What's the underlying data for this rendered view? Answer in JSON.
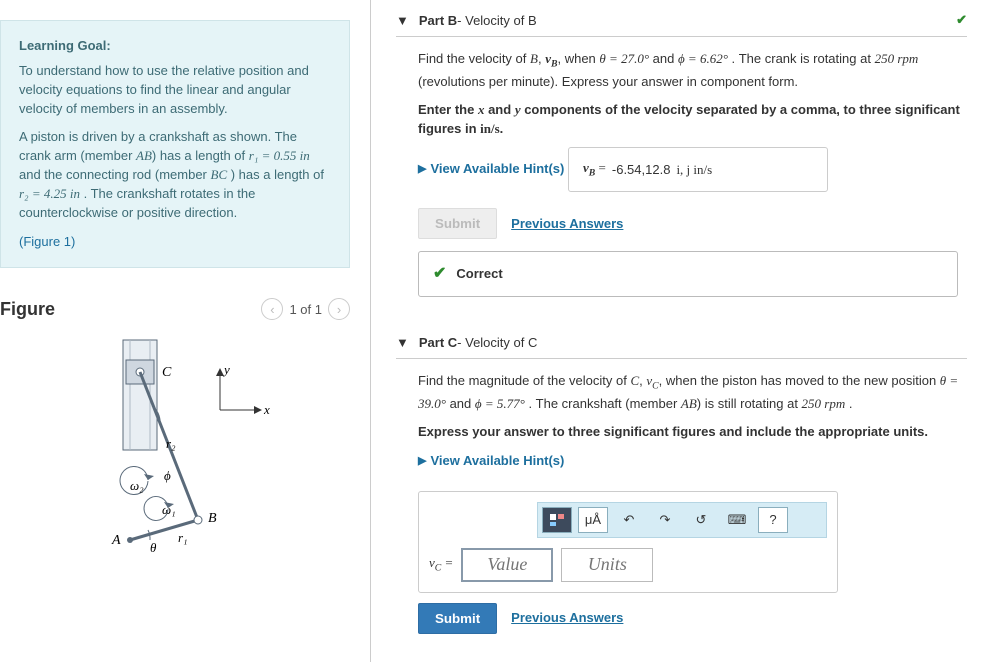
{
  "learning_goal": {
    "heading": "Learning Goal:",
    "para1": "To understand how to use the relative position and velocity equations to find the linear and angular velocity of members in an assembly.",
    "para2_pre": "A piston is driven by a crankshaft as shown. The crank arm (member ",
    "para2_AB": "AB",
    "para2_mid1": ") has a length of ",
    "r1_eq": "r₁ = 0.55 in",
    "para2_mid2": " and the connecting rod (member ",
    "para2_BC": "BC",
    "para2_mid3": " ) has a length of ",
    "r2_eq": "r₂ = 4.25 in",
    "para2_end": " . The crankshaft rotates in the counterclockwise or positive direction.",
    "figure_link": "(Figure 1)"
  },
  "figure": {
    "title": "Figure",
    "pager": "1 of 1"
  },
  "partB": {
    "header_label": "Part B",
    "header_sub": " - Velocity of B",
    "prompt_1": "Find the velocity of ",
    "B": "B",
    "prompt_2": ", ",
    "vB": "v",
    "prompt_2b": ", when ",
    "theta": "θ = 27.0°",
    "prompt_3": " and ",
    "phi": "ϕ = 6.62°",
    "prompt_4": " . The crank is rotating at ",
    "rpm": "250 rpm",
    "prompt_5": " (revolutions per minute). Express your answer in component form.",
    "instr": "Enter the x and y components of the velocity separated by a comma, to three significant figures in in/s.",
    "hints": "View Available Hint(s)",
    "ans_prefix": "v",
    "ans_eq": " = ",
    "ans_val": "-6.54,12.8",
    "ans_units": "  i, j in/s",
    "submit": "Submit",
    "prev": "Previous Answers",
    "correct": "Correct"
  },
  "partC": {
    "header_label": "Part C",
    "header_sub": " - Velocity of C",
    "prompt_1": "Find the magnitude of the velocity of ",
    "C": "C",
    "prompt_2": ", ",
    "vC": "v",
    "prompt_2b": ", when the piston has moved to the new position ",
    "theta": "θ = 39.0°",
    "prompt_3": " and ",
    "phi": "ϕ = 5.77°",
    "prompt_4": " . The crankshaft (member ",
    "AB": "AB",
    "prompt_5": ") is still rotating at ",
    "rpm": "250 rpm",
    "prompt_6": " .",
    "instr": "Express your answer to three significant figures and include the appropriate units.",
    "hints": "View Available Hint(s)",
    "toolbar": {
      "units_btn": "μÅ",
      "help": "?"
    },
    "vc_label": "v",
    "vc_eq": " = ",
    "value_ph": "Value",
    "units_ph": "Units",
    "submit": "Submit",
    "prev": "Previous Answers"
  }
}
